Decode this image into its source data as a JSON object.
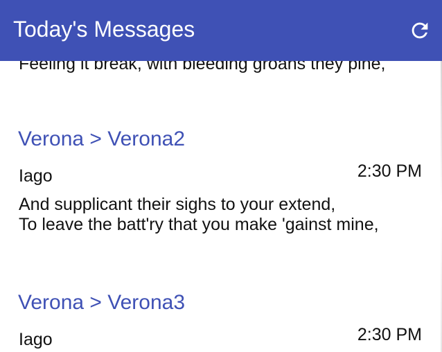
{
  "app_bar": {
    "title": "Today's Messages",
    "refresh_icon": "refresh-icon",
    "color": "#3f51b5"
  },
  "partial_previous_line": "Feeling it break, with bleeding groans they pine,",
  "messages": [
    {
      "title": "Verona > Verona2",
      "sender": "Iago",
      "time": "2:30 PM",
      "body": [
        "And supplicant their sighs to your extend,",
        "To leave the batt'ry that you make 'gainst mine,"
      ]
    },
    {
      "title": "Verona > Verona3",
      "sender": "Iago",
      "time": "2:30 PM",
      "body": []
    }
  ],
  "colors": {
    "accent": "#3f51b5",
    "text": "#111111",
    "background": "#ffffff"
  }
}
